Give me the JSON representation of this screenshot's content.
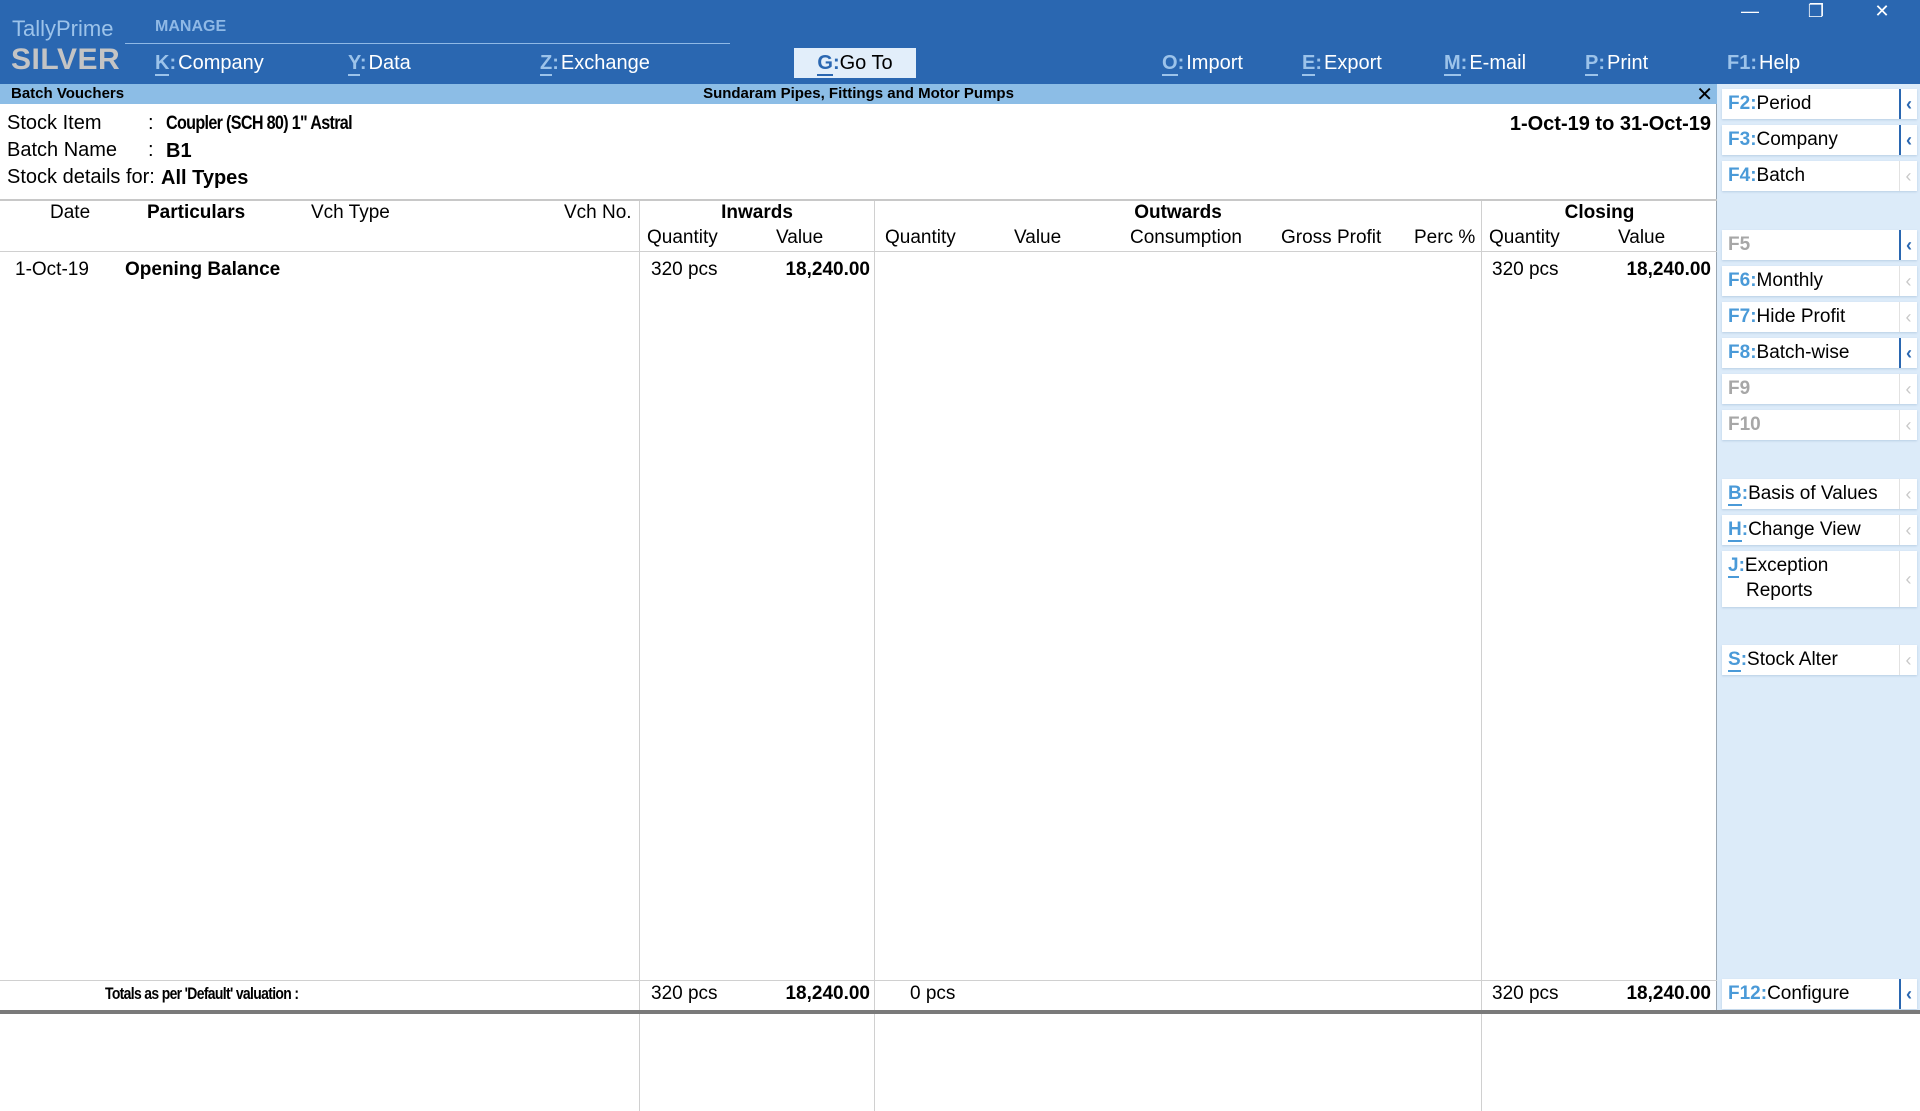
{
  "app": {
    "brand_name": "TallyPrime",
    "edition": "SILVER"
  },
  "topbar": {
    "section_label": "MANAGE",
    "menu": [
      {
        "key": "K",
        "label": "Company"
      },
      {
        "key": "Y",
        "label": "Data"
      },
      {
        "key": "Z",
        "label": "Exchange"
      },
      {
        "key": "G",
        "label": "Go To"
      },
      {
        "key": "O",
        "label": "Import"
      },
      {
        "key": "E",
        "label": "Export"
      },
      {
        "key": "M",
        "label": "E-mail"
      },
      {
        "key": "P",
        "label": "Print"
      },
      {
        "key": "F1",
        "label": "Help"
      }
    ],
    "window_controls": {
      "minimize": "—",
      "restore": "❐",
      "close": "✕"
    }
  },
  "title_strip": {
    "report_name": "Batch Vouchers",
    "company_name": "Sundaram Pipes, Fittings and Motor Pumps",
    "close_glyph": "✕"
  },
  "report_info": {
    "stock_item_label": "Stock Item",
    "stock_item_value": "Coupler (SCH 80) 1\" Astral",
    "batch_name_label": "Batch Name",
    "batch_name_value": "B1",
    "stock_details_label": "Stock details for:",
    "stock_details_value": "All Types",
    "colon": ":",
    "period": "1-Oct-19 to 31-Oct-19"
  },
  "table": {
    "headers": {
      "date": "Date",
      "particulars": "Particulars",
      "vch_type": "Vch Type",
      "vch_no": "Vch No.",
      "inwards": "Inwards",
      "outwards": "Outwards",
      "closing": "Closing",
      "quantity": "Quantity",
      "value": "Value",
      "consumption": "Consumption",
      "gross_profit": "Gross Profit",
      "perc": "Perc %"
    },
    "rows": [
      {
        "date": "1-Oct-19",
        "particulars": "Opening Balance",
        "vch_type": "",
        "vch_no": "",
        "inwards_qty": "320 pcs",
        "inwards_value": "18,240.00",
        "outwards_qty": "",
        "outwards_value": "",
        "consumption": "",
        "gross_profit": "",
        "perc": "",
        "closing_qty": "320 pcs",
        "closing_value": "18,240.00"
      }
    ],
    "totals": {
      "label": "Totals as per 'Default' valuation :",
      "inwards_qty": "320 pcs",
      "inwards_value": "18,240.00",
      "outwards_qty": "0 pcs",
      "closing_qty": "320 pcs",
      "closing_value": "18,240.00"
    }
  },
  "sidebar": {
    "chevron": "‹",
    "buttons": [
      {
        "key": "F2",
        "label": "Period",
        "enabled": true
      },
      {
        "key": "F3",
        "label": "Company",
        "enabled": true
      },
      {
        "key": "F4",
        "label": "Batch",
        "enabled": true
      },
      {
        "key": "F5",
        "label": "",
        "enabled": false
      },
      {
        "key": "F6",
        "label": "Monthly",
        "enabled": true
      },
      {
        "key": "F7",
        "label": "Hide Profit",
        "enabled": true
      },
      {
        "key": "F8",
        "label": "Batch-wise",
        "enabled": true
      },
      {
        "key": "F9",
        "label": "",
        "enabled": false
      },
      {
        "key": "F10",
        "label": "",
        "enabled": false
      },
      {
        "key": "B",
        "label": "Basis of Values",
        "enabled": true
      },
      {
        "key": "H",
        "label": "Change View",
        "enabled": true
      },
      {
        "key": "J",
        "label": "Exception",
        "label_line2": "Reports",
        "enabled": true
      },
      {
        "key": "S",
        "label": "Stock Alter",
        "enabled": true
      },
      {
        "key": "F12",
        "label": "Configure",
        "enabled": true
      }
    ]
  },
  "colors": {
    "topbar_bg": "#2a67b1",
    "title_strip_bg": "#8cbde6",
    "sidebar_bg": "#dcebf9",
    "key_accent": "#4a9ad8"
  }
}
